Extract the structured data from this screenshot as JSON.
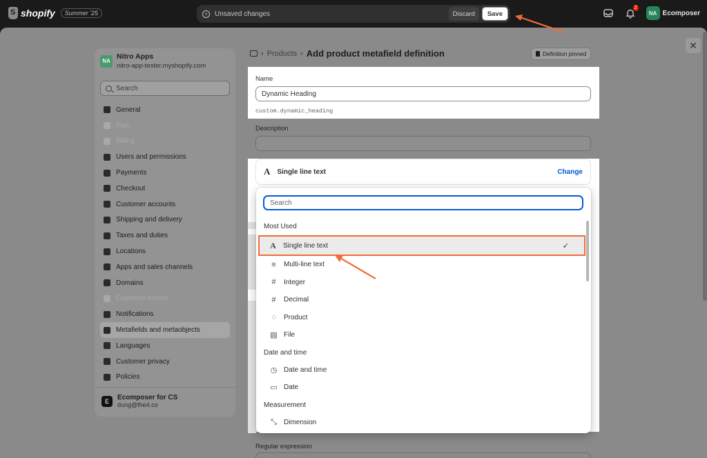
{
  "topbar": {
    "logo": "shopify",
    "edition": "Summer '25",
    "unsaved": "Unsaved changes",
    "discard": "Discard",
    "save": "Save",
    "notif_count": "2",
    "user_initials": "NA",
    "user_name": "Ecomposer"
  },
  "sidebar": {
    "store_initials": "NA",
    "store_name": "Nitro Apps",
    "store_url": "nitro-app-tester.myshopify.com",
    "search_placeholder": "Search",
    "items": [
      {
        "label": "General",
        "icon": "store-icon",
        "state": "normal"
      },
      {
        "label": "Plan",
        "icon": "chart-icon",
        "state": "dim"
      },
      {
        "label": "Billing",
        "icon": "receipt-icon",
        "state": "dim"
      },
      {
        "label": "Users and permissions",
        "icon": "users-icon",
        "state": "normal"
      },
      {
        "label": "Payments",
        "icon": "payments-icon",
        "state": "normal"
      },
      {
        "label": "Checkout",
        "icon": "cart-icon",
        "state": "normal"
      },
      {
        "label": "Customer accounts",
        "icon": "person-icon",
        "state": "normal"
      },
      {
        "label": "Shipping and delivery",
        "icon": "truck-icon",
        "state": "normal"
      },
      {
        "label": "Taxes and duties",
        "icon": "tax-icon",
        "state": "normal"
      },
      {
        "label": "Locations",
        "icon": "location-icon",
        "state": "normal"
      },
      {
        "label": "Apps and sales channels",
        "icon": "apps-icon",
        "state": "normal"
      },
      {
        "label": "Domains",
        "icon": "domain-icon",
        "state": "normal"
      },
      {
        "label": "Customer events",
        "icon": "sparkle-icon",
        "state": "dim"
      },
      {
        "label": "Notifications",
        "icon": "bell-icon",
        "state": "normal"
      },
      {
        "label": "Metafields and metaobjects",
        "icon": "metafield-icon",
        "state": "active"
      },
      {
        "label": "Languages",
        "icon": "language-icon",
        "state": "normal"
      },
      {
        "label": "Customer privacy",
        "icon": "lock-icon",
        "state": "normal"
      },
      {
        "label": "Policies",
        "icon": "policy-icon",
        "state": "normal"
      }
    ],
    "footer_name": "Ecomposer for CS",
    "footer_email": "dung@the4.co"
  },
  "header": {
    "breadcrumb": "Products",
    "title": "Add product metafield definition",
    "pinned": "Definition pinned"
  },
  "form": {
    "name_label": "Name",
    "name_value": "Dynamic Heading",
    "namespace_key": "custom.dynamic_heading",
    "description_label": "Description",
    "type_label": "Single line text",
    "change": "Change",
    "regex_label": "Regular expression"
  },
  "dropdown": {
    "search_placeholder": "Search",
    "groups": [
      {
        "label": "Most Used",
        "items": [
          {
            "label": "Single line text",
            "icon": "text-a-icon",
            "selected": true
          },
          {
            "label": "Multi-line text",
            "icon": "paragraph-icon",
            "selected": false
          },
          {
            "label": "Integer",
            "icon": "hash-icon",
            "selected": false
          },
          {
            "label": "Decimal",
            "icon": "hash-icon",
            "selected": false
          },
          {
            "label": "Product",
            "icon": "product-icon",
            "selected": false
          },
          {
            "label": "File",
            "icon": "file-icon",
            "selected": false
          }
        ]
      },
      {
        "label": "Date and time",
        "items": [
          {
            "label": "Date and time",
            "icon": "calendar-clock-icon",
            "selected": false
          },
          {
            "label": "Date",
            "icon": "calendar-icon",
            "selected": false
          }
        ]
      },
      {
        "label": "Measurement",
        "items": [
          {
            "label": "Dimension",
            "icon": "dimension-icon",
            "selected": false
          }
        ]
      }
    ]
  },
  "colors": {
    "accent_blue": "#005bd3",
    "highlight": "#f26b3a",
    "avatar_green": "#29845a"
  }
}
